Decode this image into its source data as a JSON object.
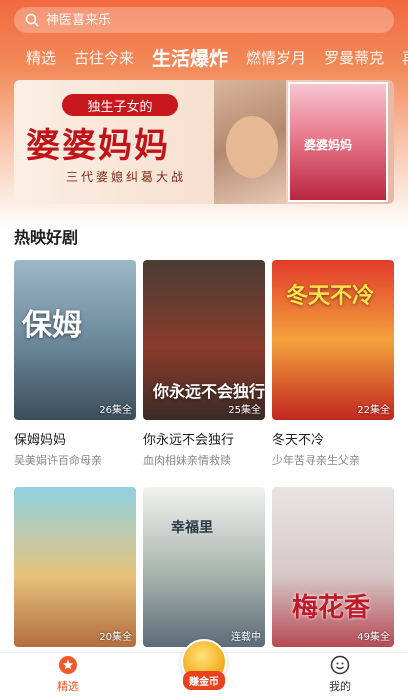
{
  "search": {
    "placeholder": "神医喜来乐"
  },
  "tabs": [
    {
      "label": "精选"
    },
    {
      "label": "古往今来"
    },
    {
      "label": "生活爆炸"
    },
    {
      "label": "燃情岁月"
    },
    {
      "label": "罗曼蒂克"
    },
    {
      "label": "再"
    }
  ],
  "banner": {
    "tag": "独生子女的",
    "title": "婆婆妈妈",
    "subtitle": "三代婆媳纠葛大战",
    "poster_title": "婆婆妈妈"
  },
  "section": {
    "title": "热映好剧"
  },
  "cards": [
    {
      "name": "保姆妈妈",
      "desc": "吴美娟许百命母亲",
      "eps": "26集全",
      "cover_text": "保姆"
    },
    {
      "name": "你永远不会独行",
      "desc": "血肉相妹亲情救赎",
      "eps": "25集全",
      "cover_text": "你永远不会独行"
    },
    {
      "name": "冬天不冷",
      "desc": "少年苦寻亲生父亲",
      "eps": "22集全",
      "cover_text": "冬天不冷"
    },
    {
      "name": "",
      "desc": "",
      "eps": "20集全",
      "cover_text": ""
    },
    {
      "name": "",
      "desc": "",
      "eps": "连载中",
      "cover_text": "幸福里"
    },
    {
      "name": "",
      "desc": "",
      "eps": "49集全",
      "cover_text": "梅花香"
    }
  ],
  "nav": {
    "home": "精选",
    "coin": "赚金币",
    "me": "我的"
  },
  "colors": {
    "accent": "#f05a2a",
    "banner_red": "#c8181b"
  }
}
